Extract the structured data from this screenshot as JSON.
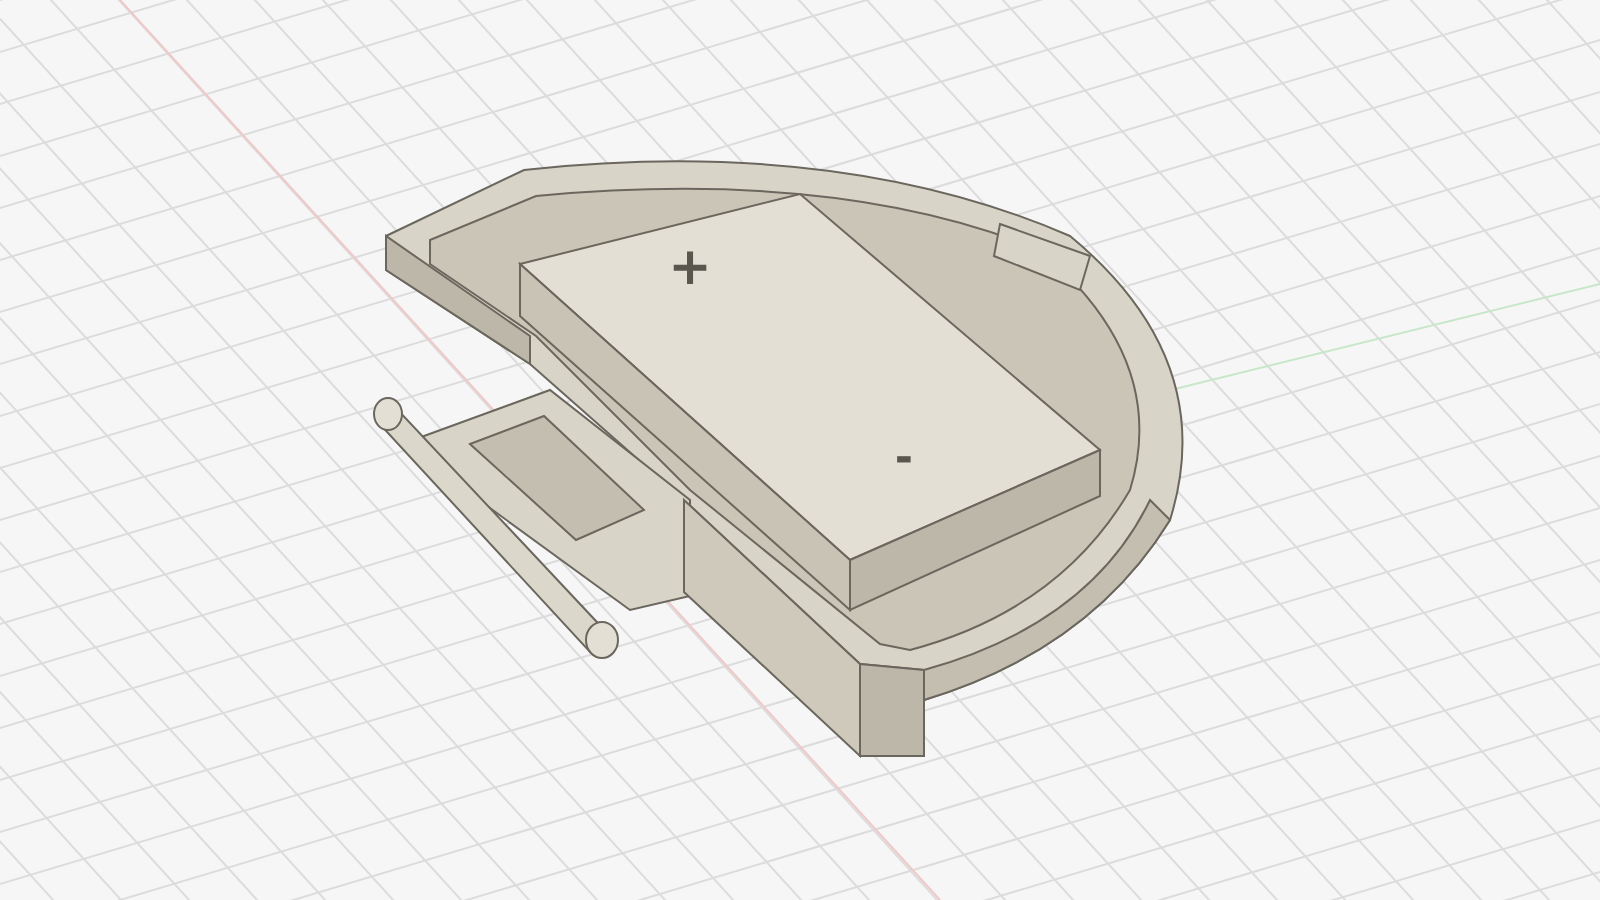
{
  "battery_markings": [
    {
      "symbol": "+"
    },
    {
      "symbol": "-"
    }
  ]
}
